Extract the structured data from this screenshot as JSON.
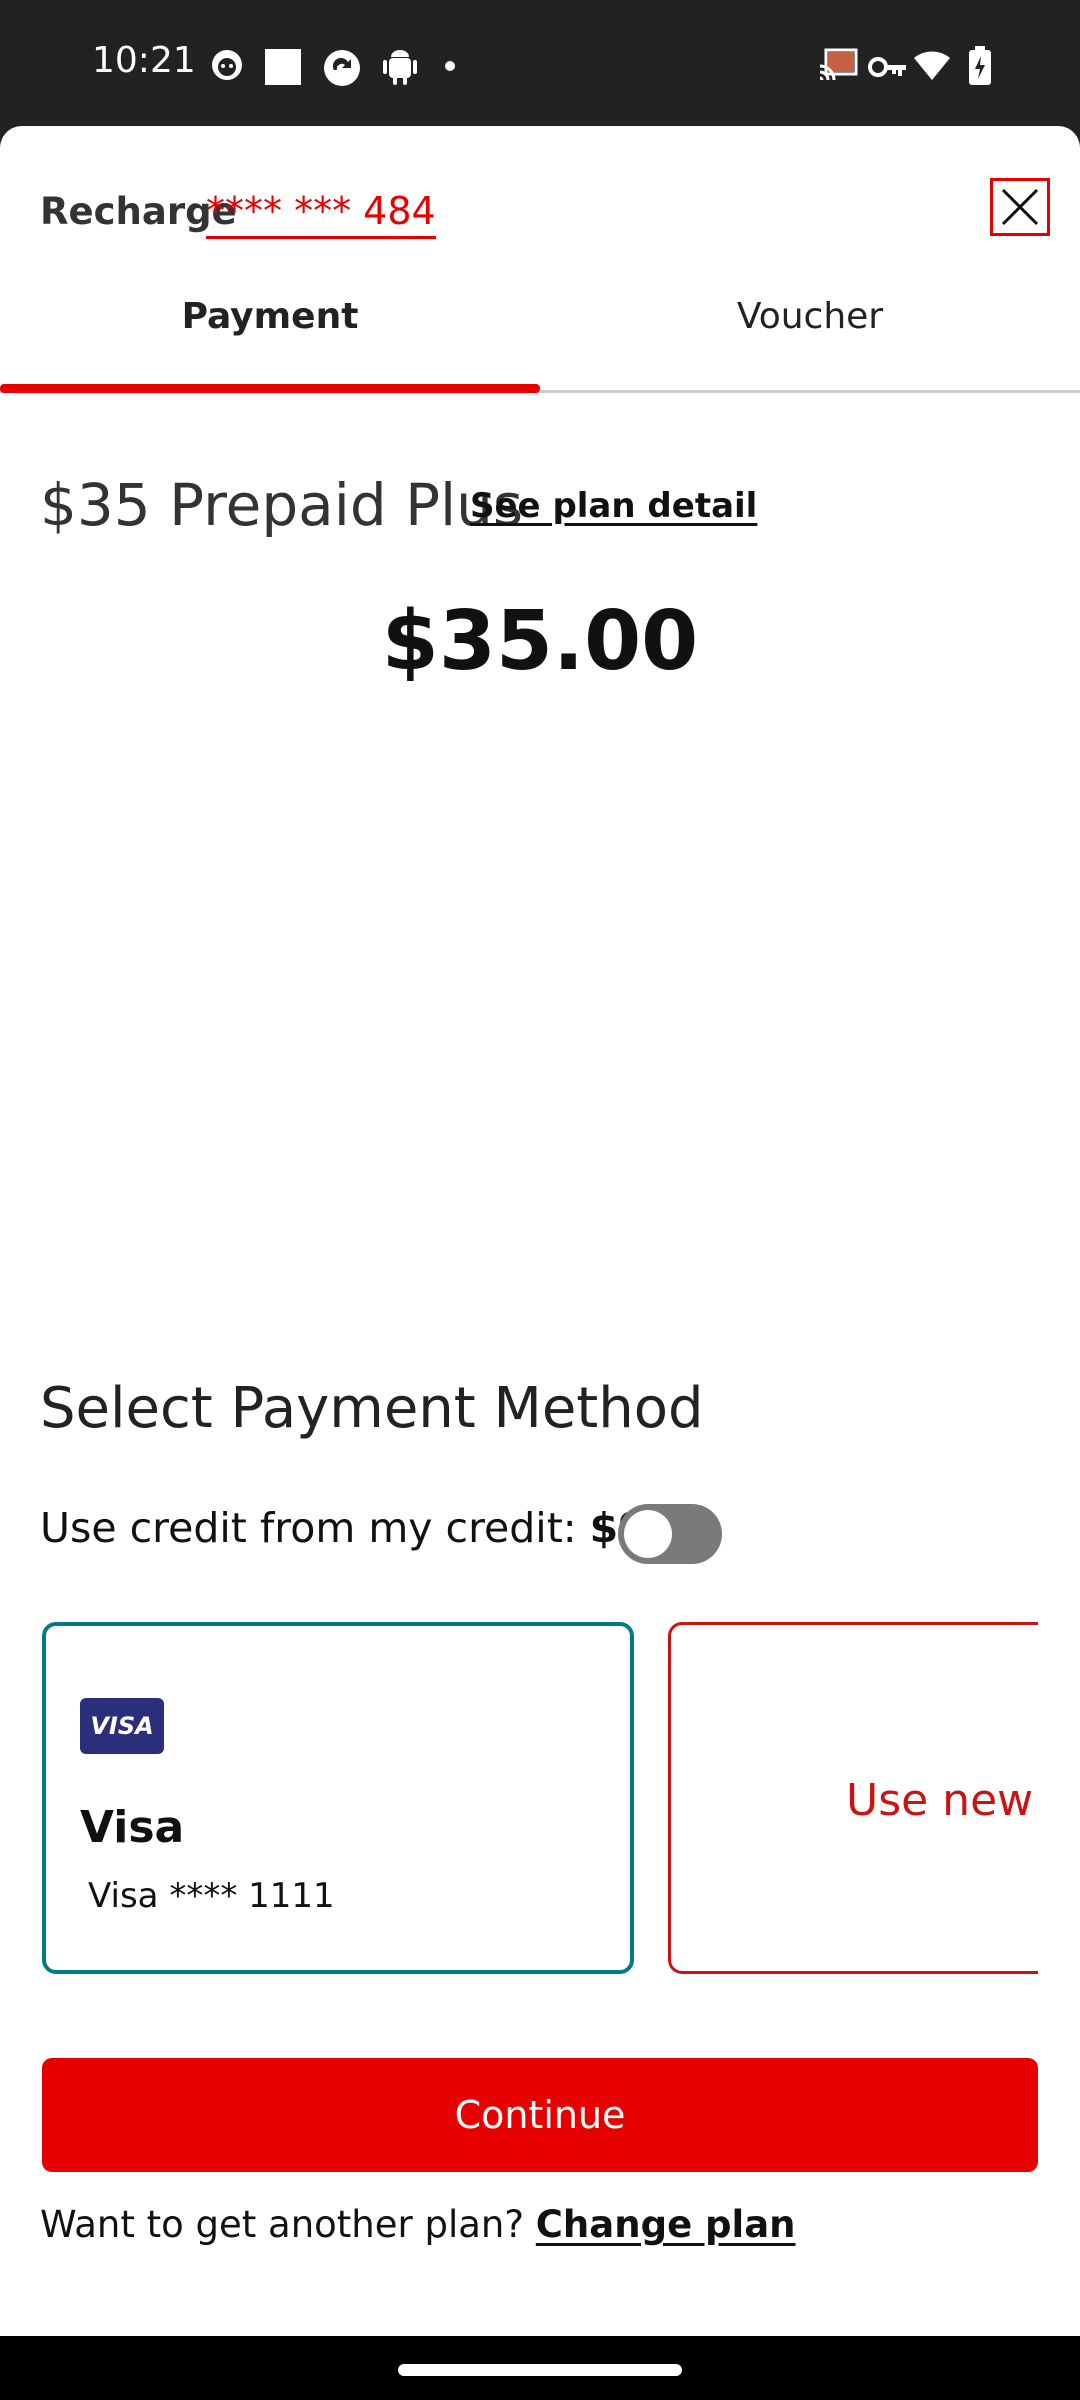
{
  "status_bar": {
    "time": "10:21",
    "left_icons": [
      "cat-face-icon",
      "square-icon",
      "sync-icon",
      "android-icon",
      "dot-icon"
    ],
    "right_icons": [
      "cast-icon",
      "vpn-key-icon",
      "wifi-icon",
      "battery-charging-icon"
    ]
  },
  "header": {
    "label": "Recharge",
    "number": "**** *** 484"
  },
  "tabs": [
    {
      "label": "Payment",
      "active": true
    },
    {
      "label": "Voucher",
      "active": false
    }
  ],
  "plan": {
    "name": "$35 Prepaid Plus",
    "detail_link": "See plan detail",
    "price": "$35.00"
  },
  "payment": {
    "section_title": "Select Payment Method",
    "credit_label": "Use credit from my credit: ",
    "credit_amount": "$93",
    "credit_toggle_on": false,
    "saved_card": {
      "logo": "VISA",
      "title": "Visa",
      "number": "Visa **** 1111"
    },
    "new_card_label": "Use new"
  },
  "actions": {
    "continue_label": "Continue",
    "change_plan_prompt": "Want to get another plan? ",
    "change_plan_link": "Change plan"
  },
  "colors": {
    "accent": "#e60000",
    "selected_border": "#007c89",
    "visa_blue": "#2b2f7a"
  }
}
